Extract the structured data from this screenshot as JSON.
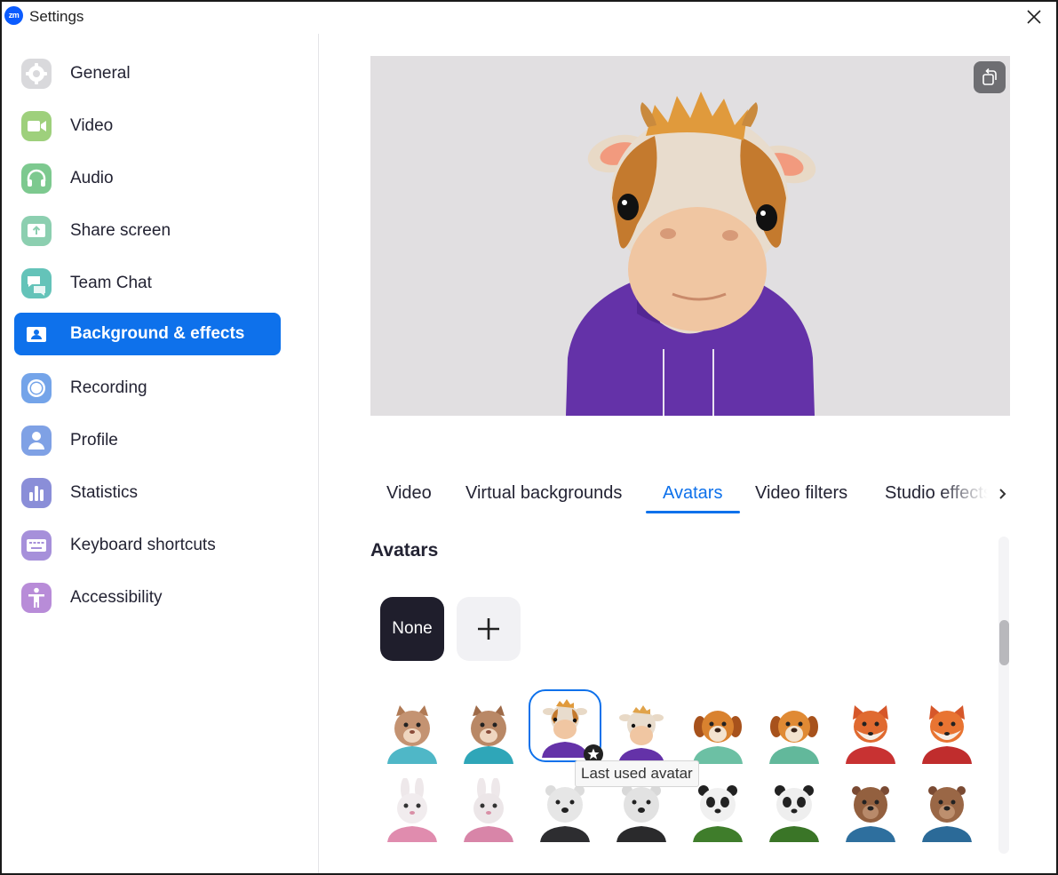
{
  "window": {
    "title": "Settings",
    "logo_text": "zm"
  },
  "sidebar": {
    "items": [
      {
        "label": "General",
        "icon": "gear-icon",
        "color": "#d9d9dc"
      },
      {
        "label": "Video",
        "icon": "video-camera-icon",
        "color": "#9ed07c"
      },
      {
        "label": "Audio",
        "icon": "headphones-icon",
        "color": "#7dc98f"
      },
      {
        "label": "Share screen",
        "icon": "share-screen-icon",
        "color": "#8ccfb0"
      },
      {
        "label": "Team Chat",
        "icon": "chat-bubbles-icon",
        "color": "#64c3b9"
      },
      {
        "label": "Background & effects",
        "icon": "background-effects-icon",
        "color": "#0e71eb",
        "active": true
      },
      {
        "label": "Recording",
        "icon": "record-icon",
        "color": "#74a4e9"
      },
      {
        "label": "Profile",
        "icon": "profile-icon",
        "color": "#7fa1e5"
      },
      {
        "label": "Statistics",
        "icon": "statistics-icon",
        "color": "#8a8ed8"
      },
      {
        "label": "Keyboard shortcuts",
        "icon": "keyboard-icon",
        "color": "#a690da"
      },
      {
        "label": "Accessibility",
        "icon": "accessibility-icon",
        "color": "#b88cd8"
      }
    ]
  },
  "tabs": [
    {
      "label": "Video"
    },
    {
      "label": "Virtual backgrounds"
    },
    {
      "label": "Avatars",
      "active": true
    },
    {
      "label": "Video filters"
    },
    {
      "label": "Studio effects"
    }
  ],
  "avatars_section": {
    "title": "Avatars",
    "none_label": "None",
    "tooltip": "Last used avatar",
    "rows": [
      [
        "cat-avatar",
        "cat-avatar",
        "cow-avatar",
        "cow-avatar",
        "dog-avatar",
        "dog-avatar",
        "fox-avatar",
        "fox-avatar"
      ],
      [
        "rabbit-avatar",
        "rabbit-avatar",
        "polar-bear-avatar",
        "polar-bear-avatar",
        "panda-avatar",
        "panda-avatar",
        "beaver-avatar",
        "beaver-avatar"
      ]
    ],
    "selected": "cow-avatar"
  },
  "colors": {
    "accent": "#0e71eb",
    "hoodie": "#6432a8"
  }
}
